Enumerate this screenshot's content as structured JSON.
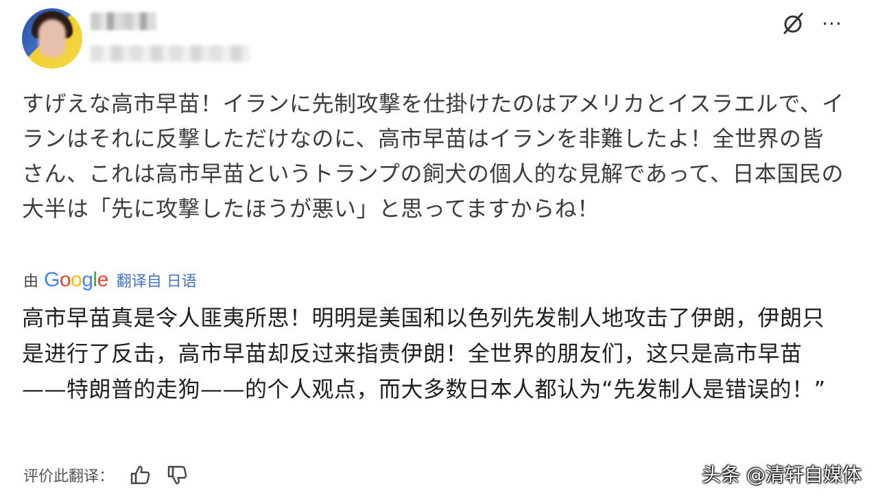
{
  "post": {
    "original_text": "すげえな高市早苗！イランに先制攻撃を仕掛けたのはアメリカとイスラエルで、イランはそれに反撃しただけなのに、高市早苗はイランを非難したよ！全世界の皆さん、これは高市早苗というトランプの飼犬の個人的な見解であって、日本国民の大半は「先に攻撃したほうが悪い」と思ってますからね！",
    "translated_text": "高市早苗真是令人匪夷所思！明明是美国和以色列先发制人地攻击了伊朗，伊朗只是进行了反击，高市早苗却反过来指责伊朗！全世界的朋友们，这只是高市早苗——特朗普的走狗——的个人观点，而大多数日本人都认为“先发制人是错误的！”"
  },
  "header": {
    "hide_icon": "eye-off-icon",
    "more_icon": "more-horizontal-icon",
    "more_glyph": "···"
  },
  "translation": {
    "by_label": "由",
    "google_logo": "Google",
    "translated_from": "翻译自 日语"
  },
  "rating": {
    "label": "评价此翻译：",
    "thumbs_up_icon": "thumbs-up-icon",
    "thumbs_down_icon": "thumbs-down-icon"
  },
  "watermark": {
    "text": "头条 @清轩自媒体"
  },
  "colors": {
    "link": "#4473c5",
    "google_blue": "#4285f4",
    "google_red": "#ea4335",
    "google_yellow": "#fbbc05",
    "google_green": "#34a853"
  }
}
